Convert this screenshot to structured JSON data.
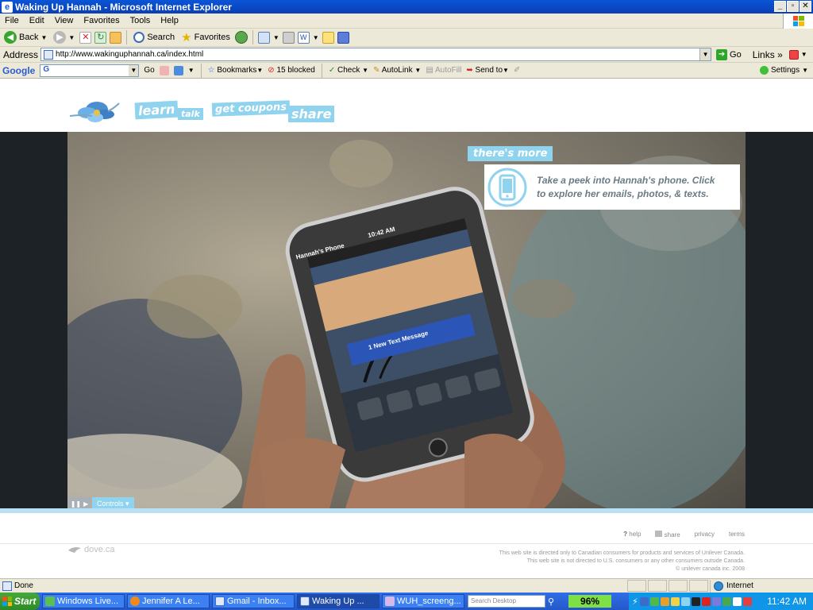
{
  "window": {
    "title": "Waking Up Hannah - Microsoft Internet Explorer"
  },
  "menu": [
    "File",
    "Edit",
    "View",
    "Favorites",
    "Tools",
    "Help"
  ],
  "toolbar": {
    "back": "Back",
    "search": "Search",
    "favorites": "Favorites"
  },
  "address": {
    "label": "Address",
    "url": "http://www.wakinguphannah.ca/index.html",
    "go": "Go",
    "links": "Links"
  },
  "google_bar": {
    "logo": "Google",
    "search_value": "G",
    "go": "Go",
    "bookmarks": "Bookmarks",
    "blocked": "15 blocked",
    "check": "Check",
    "autolink": "AutoLink",
    "autofill": "AutoFill",
    "send_to": "Send to",
    "settings": "Settings"
  },
  "site": {
    "nav": {
      "learn": "learn",
      "talk": "talk",
      "coupons": "get coupons",
      "share": "share"
    },
    "phone": {
      "time": "10:42 AM",
      "title": "Hannah's Phone",
      "message_button": "1 New Text Message"
    },
    "callout": {
      "tag": "there's more",
      "text_line1": "Take a peek into Hannah's phone. Click",
      "text_line2": "to explore her emails, photos, & texts."
    },
    "controls": {
      "label": "Controls"
    },
    "footer_links": {
      "help": "help",
      "share": "share",
      "privacy": "privacy",
      "terms": "terms"
    },
    "dove": "dove.ca",
    "legal": [
      "This web site is directed only to Canadian consumers for products and services of Unilever Canada.",
      "This web site is not directed to U.S. consumers or any other consumers outside Canada.",
      "© unilever canada inc. 2008"
    ]
  },
  "status": {
    "text": "Done",
    "zone": "Internet"
  },
  "taskbar": {
    "start": "Start",
    "tasks": [
      "Windows Live...",
      "Jennifer A Le...",
      "Gmail - Inbox...",
      "Waking Up ...",
      "WUH_screeng..."
    ],
    "search_placeholder": "Search Desktop",
    "battery": "96%",
    "clock": "11:42 AM"
  }
}
